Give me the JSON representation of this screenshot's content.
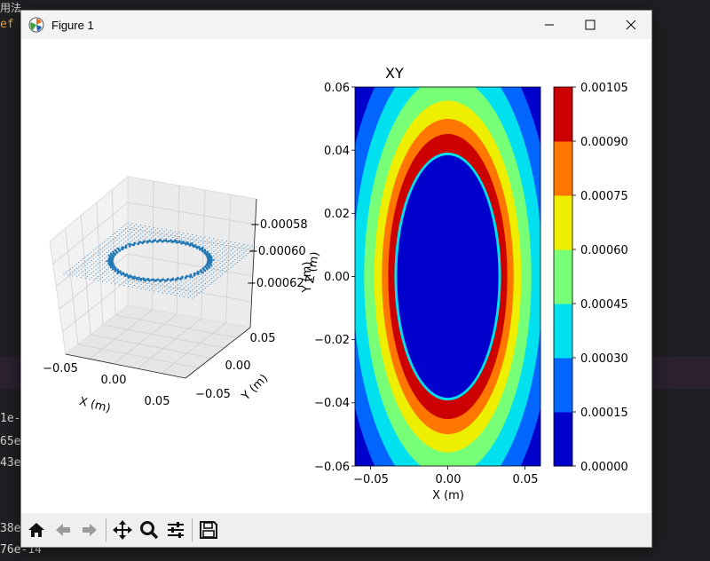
{
  "background": {
    "top_text": "用法",
    "def_text": "ef",
    "lines": [
      "1e-",
      "65e",
      "43e",
      "38e",
      "76e-14"
    ]
  },
  "window": {
    "title": "Figure 1",
    "icons": {
      "app": "matplotlib-icon",
      "minimize": "minimize-icon",
      "maximize": "maximize-icon",
      "close": "close-icon"
    }
  },
  "plot3d": {
    "title": "",
    "xlabel": "X (m)",
    "ylabel": "Y (m)",
    "zlabel": "Z (m)",
    "xticks": [
      "−0.05",
      "0.00",
      "0.05"
    ],
    "yticks": [
      "−0.05",
      "0.00",
      "0.05"
    ],
    "zticks": [
      "−0.00058",
      "−0.00060",
      "−0.00062"
    ]
  },
  "contour": {
    "title": "XY",
    "xlabel": "X (m)",
    "ylabel": "Y (m)",
    "xticks": [
      "−0.05",
      "0.00",
      "0.05"
    ],
    "yticks": [
      "0.06",
      "0.04",
      "0.02",
      "0.00",
      "−0.02",
      "−0.04",
      "−0.06"
    ],
    "colorbar_ticks": [
      "0.00105",
      "0.00090",
      "0.00075",
      "0.00060",
      "0.00045",
      "0.00030",
      "0.00015",
      "0.00000"
    ]
  },
  "chart_data": [
    {
      "type": "scatter",
      "title": "",
      "xlabel": "X (m)",
      "ylabel": "Y (m)",
      "zlabel": "Z (m)",
      "xlim": [
        -0.06,
        0.06
      ],
      "ylim": [
        -0.06,
        0.06
      ],
      "zticks": [
        -0.00058,
        -0.0006,
        -0.00062
      ],
      "description_shape": "annular ring of points",
      "ring_inner_radius": 0.04,
      "ring_outer_radius": 0.045,
      "color": "#1f77b4"
    },
    {
      "type": "heatmap",
      "title": "XY",
      "xlabel": "X (m)",
      "ylabel": "Y (m)",
      "xlim": [
        -0.06,
        0.06
      ],
      "ylim": [
        -0.06,
        0.06
      ],
      "levels": [
        0.0,
        0.00015,
        0.0003,
        0.00045,
        0.0006,
        0.00075,
        0.0009,
        0.00105
      ],
      "level_colors": [
        "#0000cc",
        "#0066ff",
        "#00e0ee",
        "#77ff77",
        "#eeee00",
        "#ff7700",
        "#cc0000"
      ],
      "hole_radius": 0.04,
      "colormap": "jet"
    }
  ],
  "toolbar": {
    "buttons": [
      "home-icon",
      "back-icon",
      "forward-icon",
      "pan-icon",
      "zoom-icon",
      "configure-icon",
      "save-icon"
    ]
  }
}
